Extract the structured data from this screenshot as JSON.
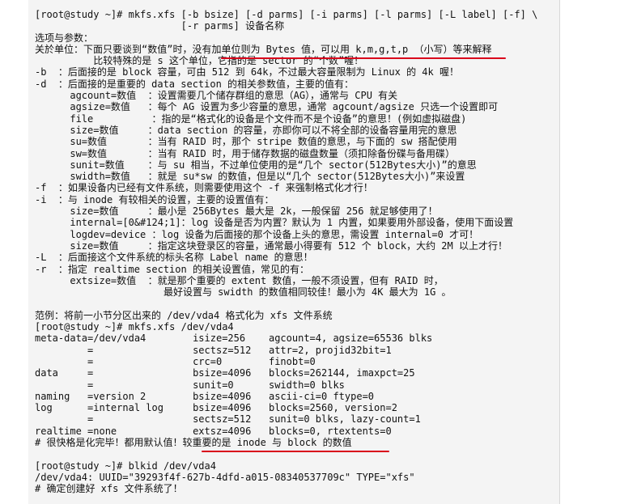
{
  "lines": [
    "[root@study ~]# mkfs.xfs [-b bsize] [-d parms] [-i parms] [-l parms] [-L label] [-f] \\",
    "                         [-r parms] 设备名称",
    "选项与参数：",
    "关於单位：下面只要谈到“数值”时，没有加单位则为 Bytes 值，可以用 k,m,g,t,p （小写）等来解释",
    "          比较特殊的是 s 这个单位，它指的是 sector 的“个数”喔！",
    "-b  ：后面接的是 block 容量，可由 512 到 64k，不过最大容量限制为 Linux 的 4k 喔！",
    "-d  ：后面接的是重要的 data section 的相关参数值，主要的值有：",
    "      agcount=数值  ：设置需要几个储存群组的意思（AG），通常与 CPU 有关",
    "      agsize=数值   ：每个 AG 设置为多少容量的意思，通常 agcount/agsize 只选一个设置即可",
    "      file          ：指的是“格式化的设备是个文件而不是个设备”的意思！(例如虚拟磁盘)",
    "      size=数值     ：data section 的容量，亦即你可以不将全部的设备容量用完的意思",
    "      su=数值       ：当有 RAID 时，那个 stripe 数值的意思，与下面的 sw 搭配使用",
    "      sw=数值       ：当有 RAID 时，用于储存数据的磁盘数量（须扣除备份碟与备用碟）",
    "      sunit=数值    ：与 su 相当，不过单位使用的是“几个 sector(512Bytes大小)”的意思",
    "      swidth=数值   ：就是 su*sw 的数值，但是以“几个 sector(512Bytes大小)”来设置",
    "-f  ：如果设备内已经有文件系统，则需要使用这个 -f 来强制格式化才行！",
    "-i  ：与 inode 有较相关的设置，主要的设置值有：",
    "      size=数值     ：最小是 256Bytes 最大是 2k，一般保留 256 就足够使用了！",
    "      internal=[0&#124;1]：log 设备是否为内置？默认为 1 内置，如果要用外部设备，使用下面设置",
    "      logdev=device ：log 设备为后面接的那个设备上头的意思，需设置 internal=0 才可！",
    "      size=数值     ：指定这块登录区的容量，通常最小得要有 512 个 block，大约 2M 以上才行！",
    "-L  ：后面接这个文件系统的标头名称 Label name 的意思！",
    "-r  ：指定 realtime section 的相关设置值，常见的有：",
    "      extsize=数值  ：就是那个重要的 extent 数值，一般不须设置，但有 RAID 时，",
    "                      最好设置与 swidth 的数值相同较佳！最小为 4K 最大为 1G 。",
    "",
    "范例：将前一小节分区出来的 /dev/vda4 格式化为 xfs 文件系统",
    "[root@study ~]# mkfs.xfs /dev/vda4",
    "meta-data=/dev/vda4        isize=256    agcount=4, agsize=65536 blks",
    "         =                 sectsz=512   attr=2, projid32bit=1",
    "         =                 crc=0        finobt=0",
    "data     =                 bsize=4096   blocks=262144, imaxpct=25",
    "         =                 sunit=0      swidth=0 blks",
    "naming   =version 2        bsize=4096   ascii-ci=0 ftype=0",
    "log      =internal log     bsize=4096   blocks=2560, version=2",
    "         =                 sectsz=512   sunit=0 blks, lazy-count=1",
    "realtime =none             extsz=4096   blocks=0, rtextents=0",
    "# 很快格是化完毕！都用默认值！较重要的是 inode 与 block 的数值",
    "",
    "[root@study ~]# blkid /dev/vda4",
    "/dev/vda4: UUID=\"39293f4f-627b-4dfd-a015-08340537709c\" TYPE=\"xfs\"",
    "# 确定创建好 xfs 文件系统了！"
  ]
}
